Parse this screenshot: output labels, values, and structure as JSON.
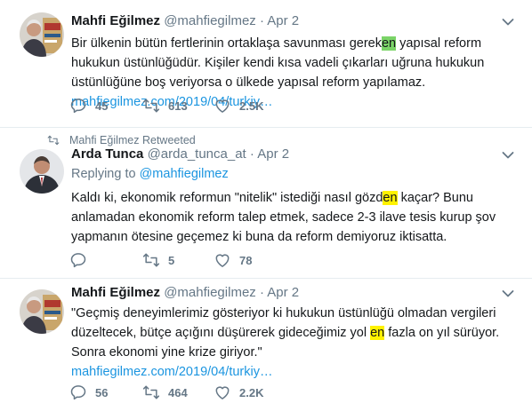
{
  "tweets": [
    {
      "name": "Mahfi Eğilmez",
      "handle": "@mahfiegilmez",
      "dot": "·",
      "time": "Apr 2",
      "text": {
        "p1": "Bir ülkenin bütün fertlerinin ortaklaşa savunması gerek",
        "hl": "en",
        "p2": " yapısal reform hukukun üstünlüğüdür. Kişiler kendi kısa vadeli çıkarları uğruna hukukun üstünlüğüne boş veriyorsa o ülkede yapısal reform yapılamaz. ",
        "link": "mahfiegilmez.com/2019/04/turkiy…"
      },
      "replies": "45",
      "retweets": "613",
      "likes": "2.5K"
    },
    {
      "retweeted_by": "Mahfi Eğilmez Retweeted",
      "name": "Arda Tunca",
      "handle": "@arda_tunca_at",
      "dot": "·",
      "time": "Apr 2",
      "replying_label": "Replying to",
      "replying_to": "@mahfiegilmez",
      "text": {
        "p1": "Kaldı ki, ekonomik reformun \"nitelik\" istediği nasıl gözd",
        "hl": "en",
        "p2": " kaçar? Bunu anlamadan ekonomik reform talep etmek, sadece 2-3 ilave tesis kurup şov yapmanın ötesine geçemez ki buna da reform demiyoruz iktisatta."
      },
      "replies": "",
      "retweets": "5",
      "likes": "78"
    },
    {
      "name": "Mahfi Eğilmez",
      "handle": "@mahfiegilmez",
      "dot": "·",
      "time": "Apr 2",
      "text": {
        "p1": "\"Geçmiş deneyimlerimiz gösteriyor ki hukukun üstünlüğü olmadan vergileri düzeltecek, bütçe açığını düşürerek gideceğimiz yol ",
        "hl": "en",
        "p2": " fazla on yıl sürüyor. Sonra ekonomi yine krize giriyor.\"",
        "link": "mahfiegilmez.com/2019/04/turkiy…"
      },
      "replies": "56",
      "retweets": "464",
      "likes": "2.2K"
    }
  ],
  "colors": {
    "link": "#1b95e0",
    "secondary": "#657786",
    "highlight_green": "#7bd468",
    "highlight_yellow": "#fff200"
  }
}
